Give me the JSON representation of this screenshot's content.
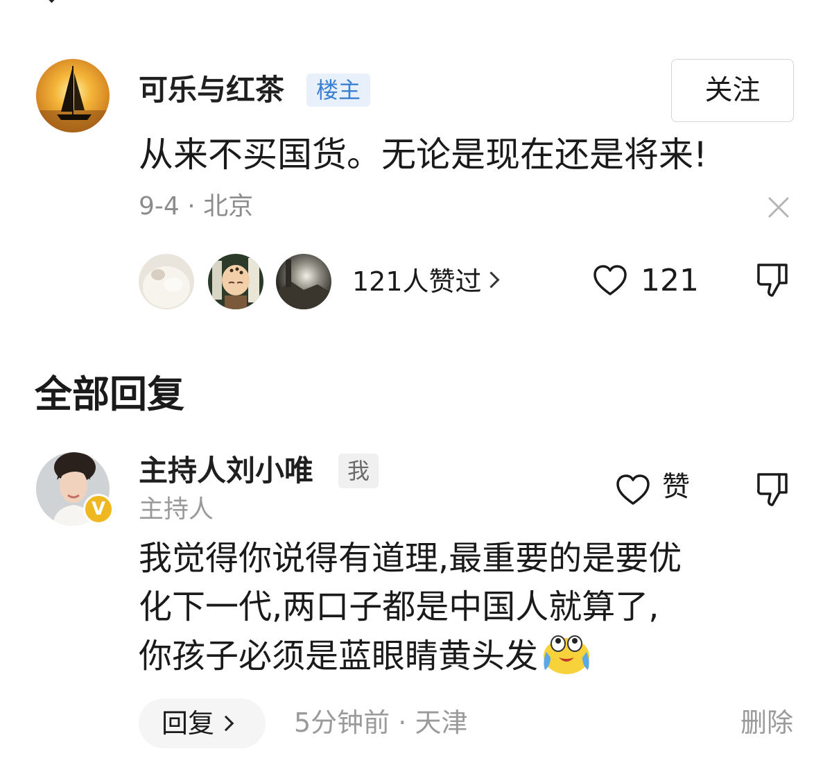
{
  "op": {
    "username": "可乐与红茶",
    "badge": "楼主",
    "follow_label": "关注",
    "content": "从来不买国货。无论是现在还是将来!",
    "date": "9-4",
    "separator": " · ",
    "location": "北京",
    "likers_text": "121人赞过",
    "like_count": "121",
    "avatar_icon": "sailboat-sunset-avatar"
  },
  "replies_section": {
    "title": "全部回复"
  },
  "reply": {
    "username": "主持人刘小唯",
    "me_badge": "我",
    "subtitle": "主持人",
    "verified_mark": "V",
    "like_label": "赞",
    "content_lines": [
      "我觉得你说得有道理,最重要的是要优",
      "化下一代,两口子都是中国人就算了,",
      "你孩子必须是蓝眼睛黄头发"
    ],
    "emoji": "crying-laughing-emoji",
    "reply_label": "回复",
    "time": "5分钟前",
    "separator": " · ",
    "location": "天津",
    "delete_label": "删除"
  },
  "colors": {
    "badge_blue": "#3a7fd0",
    "badge_blue_bg": "#e8f1fb",
    "meta_gray": "#9a9a9a",
    "verify_gold": "#f0b820"
  }
}
